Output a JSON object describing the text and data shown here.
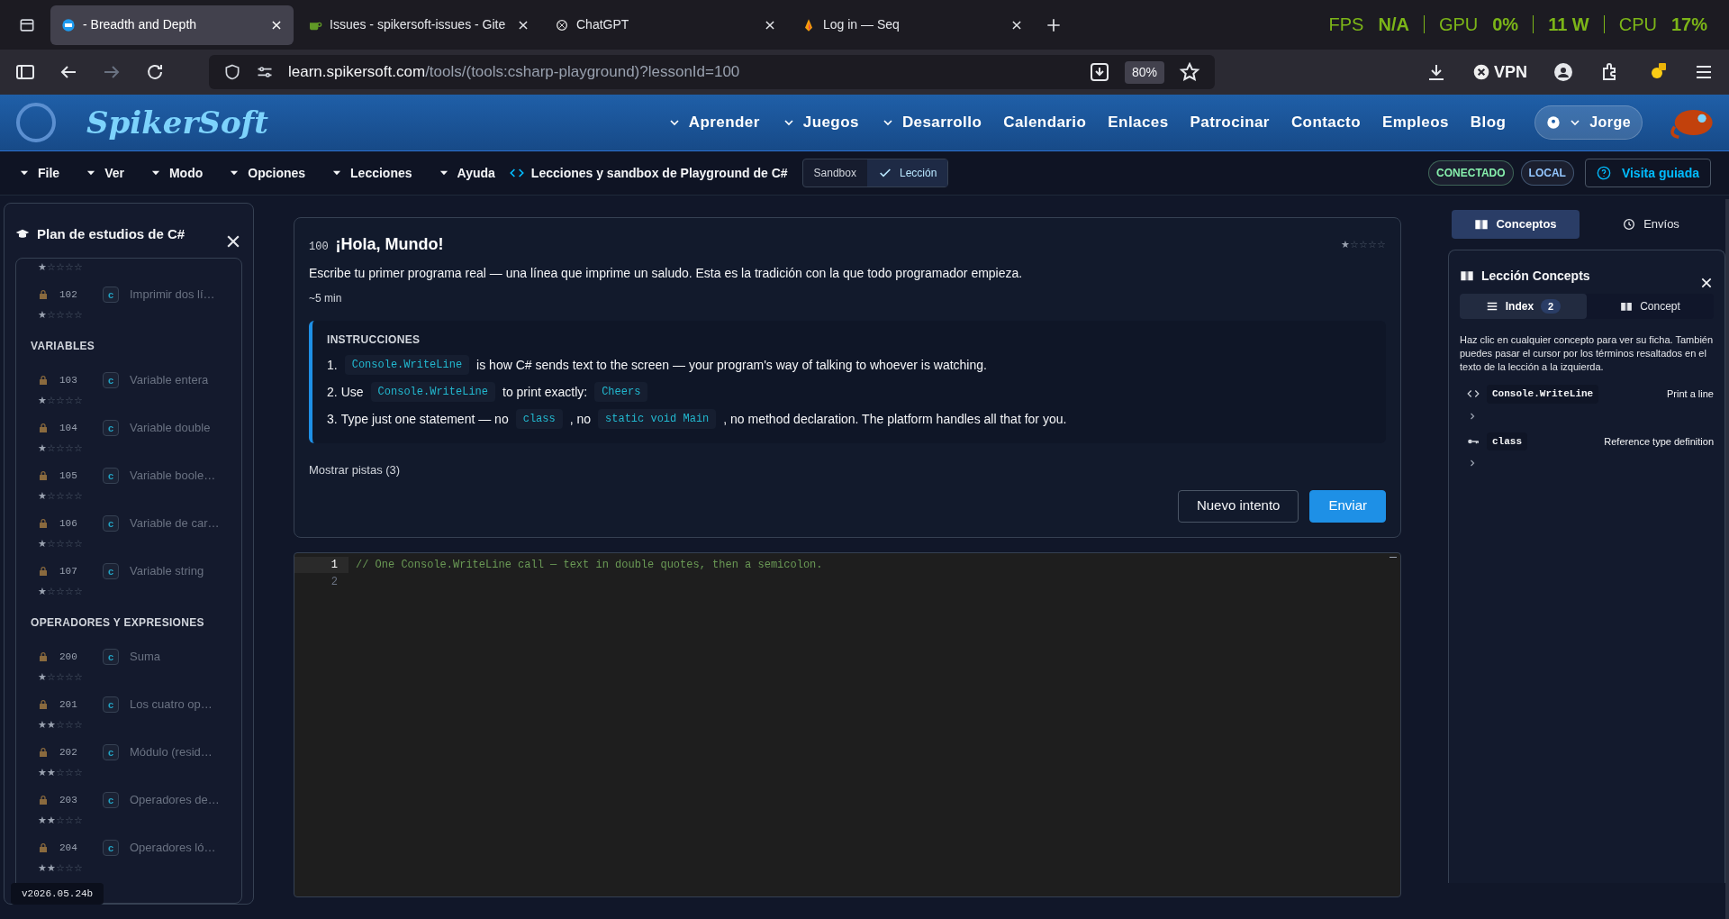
{
  "browser": {
    "tabs": [
      {
        "label": "- Breadth and Depth",
        "selected": true
      },
      {
        "label": "Issues - spikersoft-issues - Gite",
        "selected": false
      },
      {
        "label": "ChatGPT",
        "selected": false
      },
      {
        "label": "Log in — Seq",
        "selected": false
      }
    ],
    "overlay": [
      {
        "label": "FPS",
        "value": "N/A"
      },
      {
        "label": "GPU",
        "value": "0%"
      },
      {
        "value": "11 W"
      },
      {
        "label": "CPU",
        "value": "17%"
      }
    ],
    "url_domain": "learn.spikersoft.com",
    "url_path": "/tools/(tools:csharp-playground)?lessonId=100",
    "zoom": "80%",
    "vpn": "VPN"
  },
  "site_nav": {
    "logo": "SpikerSoft",
    "items": [
      {
        "label": "Aprender",
        "dropdown": true
      },
      {
        "label": "Juegos",
        "dropdown": true
      },
      {
        "label": "Desarrollo",
        "dropdown": true
      },
      {
        "label": "Calendario",
        "dropdown": false
      },
      {
        "label": "Enlaces",
        "dropdown": false
      },
      {
        "label": "Patrocinar",
        "dropdown": false
      },
      {
        "label": "Contacto",
        "dropdown": false
      },
      {
        "label": "Empleos",
        "dropdown": false
      },
      {
        "label": "Blog",
        "dropdown": false
      }
    ],
    "user": "Jorge"
  },
  "toolbar": {
    "menus": [
      "File",
      "Ver",
      "Modo",
      "Opciones",
      "Lecciones",
      "Ayuda"
    ],
    "title": "Lecciones y sandbox de Playground de C#",
    "modes": [
      {
        "label": "Sandbox",
        "selected": false
      },
      {
        "label": "Lección",
        "selected": true
      }
    ],
    "badges": [
      {
        "label": "CONECTADO",
        "color": "#86efac"
      },
      {
        "label": "LOCAL",
        "color": "#93c5fd"
      }
    ],
    "tour": "Visita guiada"
  },
  "sidebar": {
    "title": "Plan de estudios de C#",
    "sections": [
      {
        "items": [
          {
            "kind": "partial",
            "stars": 1
          },
          {
            "kind": "lesson",
            "number": "102",
            "type": "c",
            "title": "Imprimir dos lí…",
            "locked": true,
            "stars": 1
          }
        ]
      },
      {
        "heading": "VARIABLES",
        "items": [
          {
            "kind": "lesson",
            "number": "103",
            "type": "c",
            "title": "Variable entera",
            "locked": true,
            "stars": 1
          },
          {
            "kind": "lesson",
            "number": "104",
            "type": "c",
            "title": "Variable double",
            "locked": true,
            "stars": 1
          },
          {
            "kind": "lesson",
            "number": "105",
            "type": "c",
            "title": "Variable boole…",
            "locked": true,
            "stars": 1
          },
          {
            "kind": "lesson",
            "number": "106",
            "type": "c",
            "title": "Variable de car…",
            "locked": true,
            "stars": 1
          },
          {
            "kind": "lesson",
            "number": "107",
            "type": "c",
            "title": "Variable string",
            "locked": true,
            "stars": 1
          }
        ]
      },
      {
        "heading": "OPERADORES Y EXPRESIONES",
        "items": [
          {
            "kind": "lesson",
            "number": "200",
            "type": "c",
            "title": "Suma",
            "locked": true,
            "stars": 1
          },
          {
            "kind": "lesson",
            "number": "201",
            "type": "c",
            "title": "Los cuatro op…",
            "locked": true,
            "stars": 2
          },
          {
            "kind": "lesson",
            "number": "202",
            "type": "c",
            "title": "Módulo (resid…",
            "locked": true,
            "stars": 2
          },
          {
            "kind": "lesson",
            "number": "203",
            "type": "c",
            "title": "Operadores de…",
            "locked": true,
            "stars": 2
          },
          {
            "kind": "lesson",
            "number": "204",
            "type": "c",
            "title": "Operadores ló…",
            "locked": true,
            "stars": 2
          }
        ]
      }
    ],
    "version": "v2026.05.24b"
  },
  "lesson": {
    "number": "100",
    "title": "¡Hola, Mundo!",
    "stars": 1,
    "description": "Escribe tu primer programa real — una línea que imprime un saludo. Esta es la tradición con la que todo programador empieza.",
    "duration": "~5 min",
    "instructions_heading": "INSTRUCCIONES",
    "instructions": [
      {
        "number": "1.",
        "parts": [
          {
            "kind": "code",
            "text": "Console.WriteLine"
          },
          {
            "kind": "text",
            "text": "is how C# sends text to the screen — your program's way of talking to whoever is watching."
          }
        ]
      },
      {
        "number": "2.",
        "parts": [
          {
            "kind": "text",
            "text": "Use"
          },
          {
            "kind": "code",
            "text": "Console.WriteLine"
          },
          {
            "kind": "text",
            "text": "to print exactly:"
          },
          {
            "kind": "code",
            "text": "Cheers"
          }
        ]
      },
      {
        "number": "3.",
        "parts": [
          {
            "kind": "text",
            "text": "Type just one statement — no"
          },
          {
            "kind": "code",
            "text": "class"
          },
          {
            "kind": "text",
            "text": ", no"
          },
          {
            "kind": "code",
            "text": "static void Main"
          },
          {
            "kind": "text",
            "text": ", no method declaration. The platform handles all that for you."
          }
        ]
      }
    ],
    "hints": "Mostrar pistas (3)",
    "buttons": [
      {
        "label": "Nuevo intento",
        "kind": "secondary"
      },
      {
        "label": "Enviar",
        "kind": "primary"
      }
    ]
  },
  "editor": {
    "lines": [
      {
        "number": "1",
        "text": "// One Console.WriteLine call — text in double quotes, then a semicolon.",
        "selected": true
      },
      {
        "number": "2",
        "selected": false
      }
    ]
  },
  "concepts": {
    "tabs": [
      {
        "label": "Conceptos",
        "selected": true
      },
      {
        "label": "Envíos",
        "selected": false
      }
    ],
    "title": "Lección Concepts",
    "subtabs": [
      {
        "label": "Index",
        "selected": true,
        "count": "2"
      },
      {
        "label": "Concept",
        "selected": false
      }
    ],
    "help": "Haz clic en cualquier concepto para ver su ficha. También puedes pasar el cursor por los términos resaltados en el texto de la lección a la izquierda.",
    "items": [
      {
        "kind": "code",
        "term": "Console.WriteLine",
        "description": "Print a line"
      },
      {
        "kind": "key",
        "term": "class",
        "description": "Reference type definition"
      }
    ]
  }
}
